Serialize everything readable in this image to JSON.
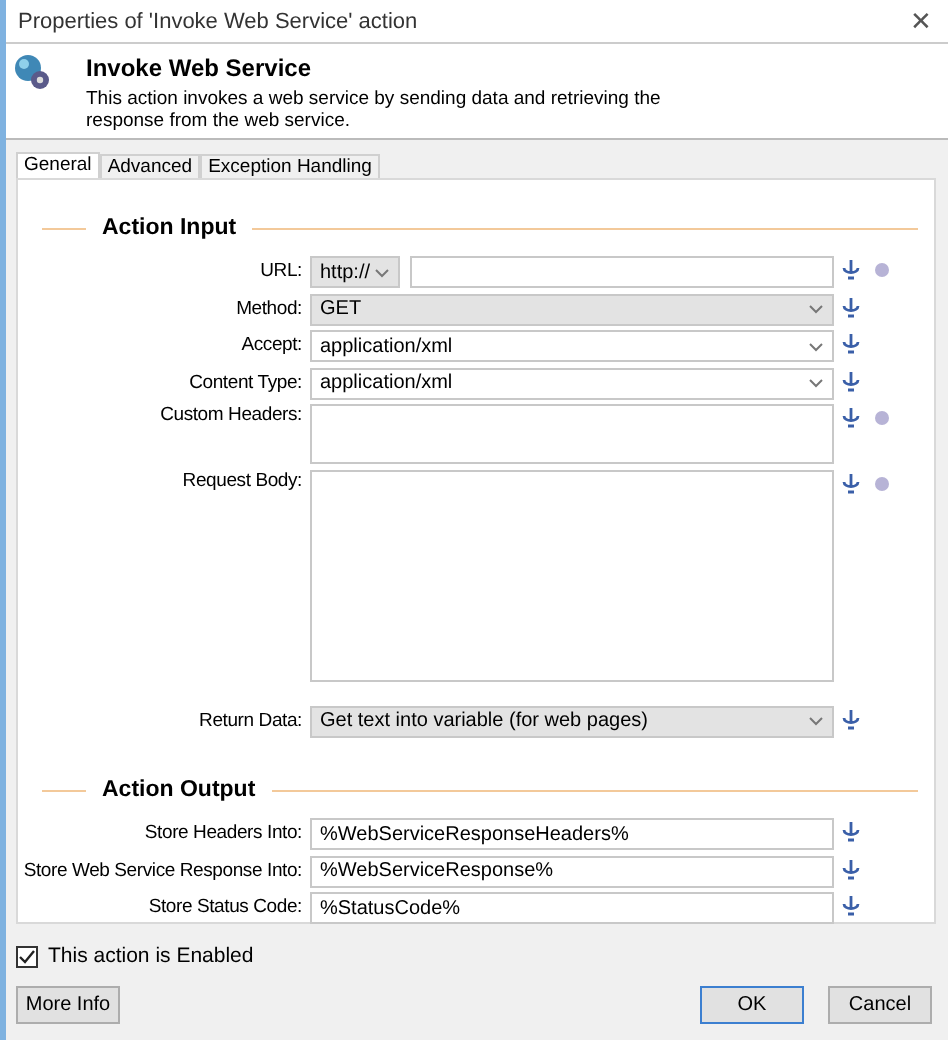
{
  "window": {
    "title": "Properties of 'Invoke Web Service' action",
    "close": "✕"
  },
  "header": {
    "title": "Invoke Web Service",
    "description": "This action invokes a web service by sending data and retrieving the response from the web service."
  },
  "tabs": [
    {
      "label": "General",
      "selected": true
    },
    {
      "label": "Advanced",
      "selected": false
    },
    {
      "label": "Exception Handling",
      "selected": false
    }
  ],
  "sections": [
    {
      "title": "Action Input",
      "rows": [
        {
          "label": "URL:",
          "kind": "url",
          "protocol": "http://",
          "value": "",
          "dot": true
        },
        {
          "label": "Method:",
          "kind": "dropdown",
          "value": "GET",
          "dot": false
        },
        {
          "label": "Accept:",
          "kind": "combo",
          "value": "application/xml",
          "dot": false
        },
        {
          "label": "Content Type:",
          "kind": "combo",
          "value": "application/xml",
          "dot": false
        },
        {
          "label": "Custom Headers:",
          "kind": "textarea",
          "value": "",
          "dot": true
        },
        {
          "label": "Request Body:",
          "kind": "bodyarea",
          "value": "",
          "dot": true
        },
        {
          "label": "Return Data:",
          "kind": "dropdown",
          "value": "Get text into variable (for web pages)",
          "dot": false
        }
      ]
    },
    {
      "title": "Action Output",
      "rows": [
        {
          "label": "Store Headers Into:",
          "kind": "text",
          "value": "%WebServiceResponseHeaders%",
          "dot": false
        },
        {
          "label": "Store Web Service Response Into:",
          "kind": "text",
          "value": "%WebServiceResponse%",
          "dot": false
        },
        {
          "label": "Store Status Code:",
          "kind": "text",
          "value": "%StatusCode%",
          "dot": false
        }
      ]
    }
  ],
  "enabled": {
    "label": "This action is Enabled",
    "checked": true
  },
  "buttons": [
    {
      "label": "More Info",
      "kind": "left"
    },
    {
      "label": "OK",
      "kind": "default"
    },
    {
      "label": "Cancel",
      "kind": "normal"
    }
  ]
}
